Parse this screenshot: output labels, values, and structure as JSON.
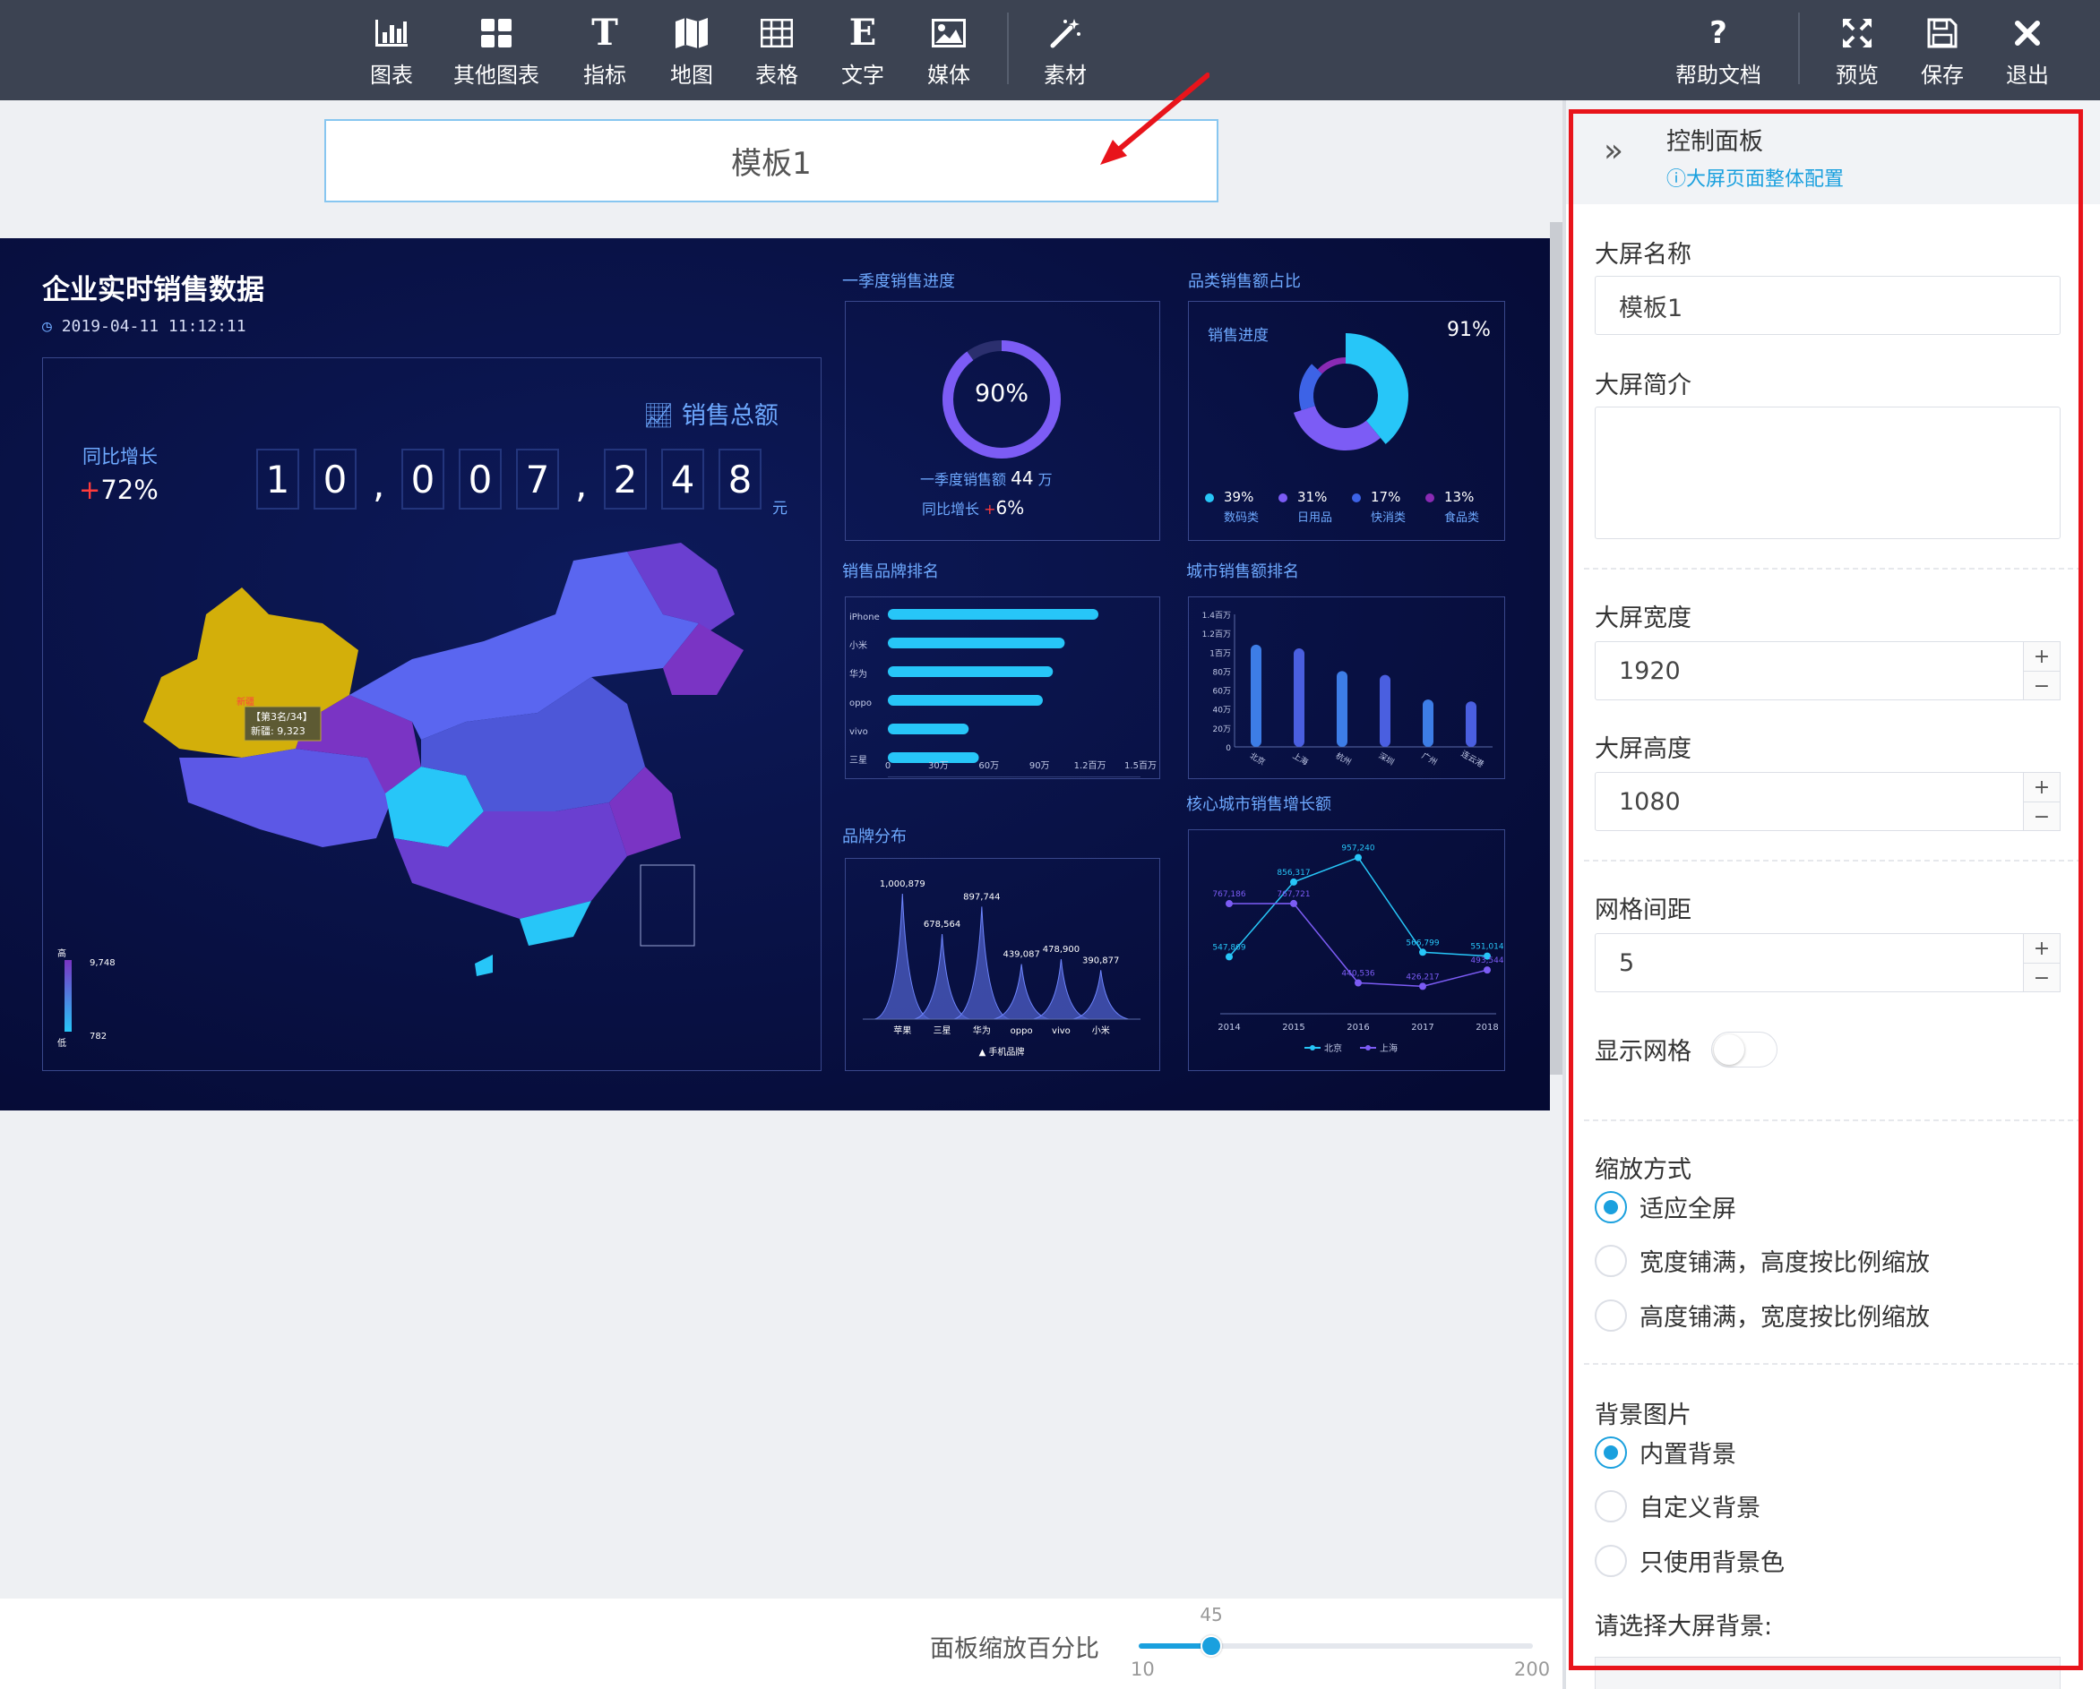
{
  "toolbar": {
    "left_tools": [
      {
        "label": "图表",
        "icon": "bar-chart-icon"
      },
      {
        "label": "其他图表",
        "icon": "grid-icon"
      },
      {
        "label": "指标",
        "icon": "text-t-icon"
      },
      {
        "label": "地图",
        "icon": "map-icon"
      },
      {
        "label": "表格",
        "icon": "table-icon"
      },
      {
        "label": "文字",
        "icon": "text-e-icon"
      },
      {
        "label": "媒体",
        "icon": "image-icon"
      },
      {
        "label": "素材",
        "icon": "magic-wand-icon"
      }
    ],
    "right_tools": [
      {
        "label": "帮助文档",
        "icon": "help-icon"
      },
      {
        "label": "预览",
        "icon": "expand-icon"
      },
      {
        "label": "保存",
        "icon": "save-icon"
      },
      {
        "label": "退出",
        "icon": "close-icon"
      }
    ]
  },
  "canvas": {
    "title_input": "模板1",
    "screen": {
      "title": "企业实时销售数据",
      "datetime": "2019-04-11 11:12:11",
      "total_label": "销售总额",
      "yoy_label": "同比增长",
      "yoy_value": "+72%",
      "yoy_plus": "+",
      "yoy_num": "72%",
      "digits": [
        "1",
        "0",
        ",",
        "0",
        "0",
        "7",
        ",",
        "2",
        "4",
        "8"
      ],
      "unit": "元",
      "map_tooltip_title": "【第3名/34】",
      "map_tooltip_value": "新疆: 9,323",
      "map_region_label": "新疆",
      "legend_high": "高",
      "legend_low": "低",
      "legend_max": "9,748",
      "legend_min": "782"
    },
    "panels": {
      "q1_title": "一季度销售进度",
      "q1_percent": "90%",
      "q1_sales_label": "一季度销售额",
      "q1_sales_value": "44",
      "q1_sales_unit": "万",
      "q1_yoy_label": "同比增长",
      "q1_yoy_value": "6%",
      "cat_title": "品类销售额占比",
      "cat_progress_label": "销售进度",
      "cat_progress_value": "91%",
      "brand_rank_title": "销售品牌排名",
      "city_rank_title": "城市销售额排名",
      "brand_dist_title": "品牌分布",
      "core_city_title": "核心城市销售增长额"
    }
  },
  "chart_data": [
    {
      "type": "pie",
      "title": "品类销售额占比",
      "categories": [
        "数码类",
        "日用品",
        "快消类",
        "食品类"
      ],
      "values": [
        39,
        31,
        17,
        13
      ],
      "value_labels": [
        "39%",
        "31%",
        "17%",
        "13%"
      ],
      "colors": [
        "#27c6f8",
        "#7c5cf5",
        "#3d63e6",
        "#8a2ab4"
      ]
    },
    {
      "type": "bar",
      "title": "销售品牌排名",
      "orientation": "horizontal",
      "categories": [
        "iPhone",
        "小米",
        "华为",
        "oppo",
        "vivo",
        "三星"
      ],
      "values": [
        1250000,
        1050000,
        980000,
        920000,
        480000,
        540000
      ],
      "xticks": [
        "0",
        "30万",
        "60万",
        "90万",
        "1.2百万",
        "1.5百万"
      ],
      "xlim": [
        0,
        1500000
      ]
    },
    {
      "type": "bar",
      "title": "城市销售额排名",
      "categories": [
        "北京",
        "上海",
        "杭州",
        "深圳",
        "广州",
        "连云港"
      ],
      "values": [
        1080000,
        1040000,
        800000,
        760000,
        500000,
        480000
      ],
      "yticks": [
        "0",
        "20万",
        "40万",
        "60万",
        "80万",
        "1百万",
        "1.2百万",
        "1.4百万"
      ],
      "ylim": [
        0,
        1400000
      ]
    },
    {
      "type": "area",
      "title": "品牌分布",
      "categories": [
        "苹果",
        "三星",
        "华为",
        "oppo",
        "vivo",
        "小米"
      ],
      "values": [
        1000879,
        678564,
        897744,
        439087,
        478900,
        390877
      ],
      "value_labels": [
        "1,000,879",
        "678,564",
        "897,744",
        "439,087",
        "478,900",
        "390,877"
      ],
      "legend": "手机品牌"
    },
    {
      "type": "line",
      "title": "核心城市销售增长额",
      "x": [
        "2014",
        "2015",
        "2016",
        "2017",
        "2018"
      ],
      "series": [
        {
          "name": "北京",
          "values": [
            547869,
            856317,
            957240,
            566799,
            551014
          ],
          "labels": [
            "547,869",
            "856,317",
            "957,240",
            "566,799",
            "551,014"
          ],
          "color": "#27c6f8"
        },
        {
          "name": "上海",
          "values": [
            767186,
            767721,
            440536,
            426217,
            493544
          ],
          "labels": [
            "767,186",
            "767,721",
            "440,536",
            "426,217",
            "493,544"
          ],
          "color": "#7c5cf5"
        }
      ],
      "ylim": [
        350000,
        1000000
      ]
    }
  ],
  "zoom": {
    "label": "面板缩放百分比",
    "value": 45,
    "value_label": "45",
    "min": 10,
    "min_label": "10",
    "max": 200,
    "max_label": "200"
  },
  "panel": {
    "title": "控制面板",
    "subtitle": "大屏页面整体配置",
    "name_label": "大屏名称",
    "name_value": "模板1",
    "intro_label": "大屏简介",
    "intro_value": "",
    "width_label": "大屏宽度",
    "width_value": "1920",
    "height_label": "大屏高度",
    "height_value": "1080",
    "grid_label": "网格间距",
    "grid_value": "5",
    "show_grid_label": "显示网格",
    "show_grid": false,
    "scale_label": "缩放方式",
    "scale_options": [
      "适应全屏",
      "宽度铺满，高度按比例缩放",
      "高度铺满，宽度按比例缩放"
    ],
    "scale_selected": 0,
    "bg_label": "背景图片",
    "bg_options": [
      "内置背景",
      "自定义背景",
      "只使用背景色"
    ],
    "bg_selected": 0,
    "bg_select_label": "请选择大屏背景:",
    "accent": "#1aa0de"
  }
}
